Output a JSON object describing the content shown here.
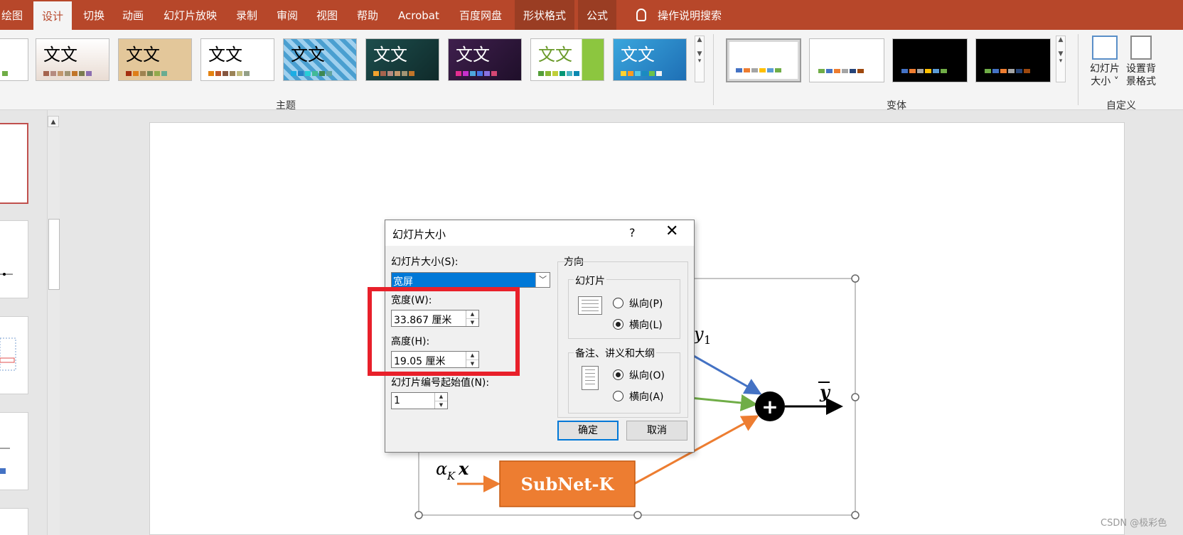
{
  "tabs": [
    {
      "label": "绘图"
    },
    {
      "label": "设计"
    },
    {
      "label": "切换"
    },
    {
      "label": "动画"
    },
    {
      "label": "幻灯片放映"
    },
    {
      "label": "录制"
    },
    {
      "label": "审阅"
    },
    {
      "label": "视图"
    },
    {
      "label": "帮助"
    },
    {
      "label": "Acrobat"
    },
    {
      "label": "百度网盘"
    },
    {
      "label": "形状格式"
    },
    {
      "label": "公式"
    }
  ],
  "active_tab": "设计",
  "tell_me": "操作说明搜索",
  "ribbon": {
    "themes_group_label": "主题",
    "theme_sample_text": "文文",
    "variants_group_label": "变体",
    "customize_group_label": "自定义",
    "slide_size_button": "幻灯片\n大小 ˅",
    "format_background_button": "设置背\n景格式"
  },
  "dialog": {
    "title": "幻灯片大小",
    "help": "?",
    "close": "✕",
    "slide_size_label": "幻灯片大小(S):",
    "slide_size_value": "宽屏",
    "width_label": "宽度(W):",
    "width_value": "33.867 厘米",
    "height_label": "高度(H):",
    "height_value": "19.05 厘米",
    "start_number_label": "幻灯片编号起始值(N):",
    "start_number_value": "1",
    "orientation_label": "方向",
    "slides_label": "幻灯片",
    "slides_portrait": "纵向(P)",
    "slides_landscape": "横向(L)",
    "slides_selected": "landscape",
    "notes_label": "备注、讲义和大纲",
    "notes_portrait": "纵向(O)",
    "notes_landscape": "横向(A)",
    "notes_selected": "portrait",
    "ok": "确定",
    "cancel": "取消"
  },
  "slide": {
    "y_bar": "y",
    "y1": "y",
    "y1_sub": "1",
    "alpha_x": "α",
    "alpha_sub": "K",
    "x": "x",
    "subnet_label": "SubNet-K",
    "plus": "+"
  },
  "watermark": "CSDN @极彩色",
  "colors": {
    "ribbon_red": "#b7472a",
    "selection_blue": "#0078d7",
    "highlight_red": "#e8202a",
    "subnet_orange": "#ed7d31",
    "arrow_blue": "#4472c4",
    "arrow_green": "#70ad47"
  }
}
